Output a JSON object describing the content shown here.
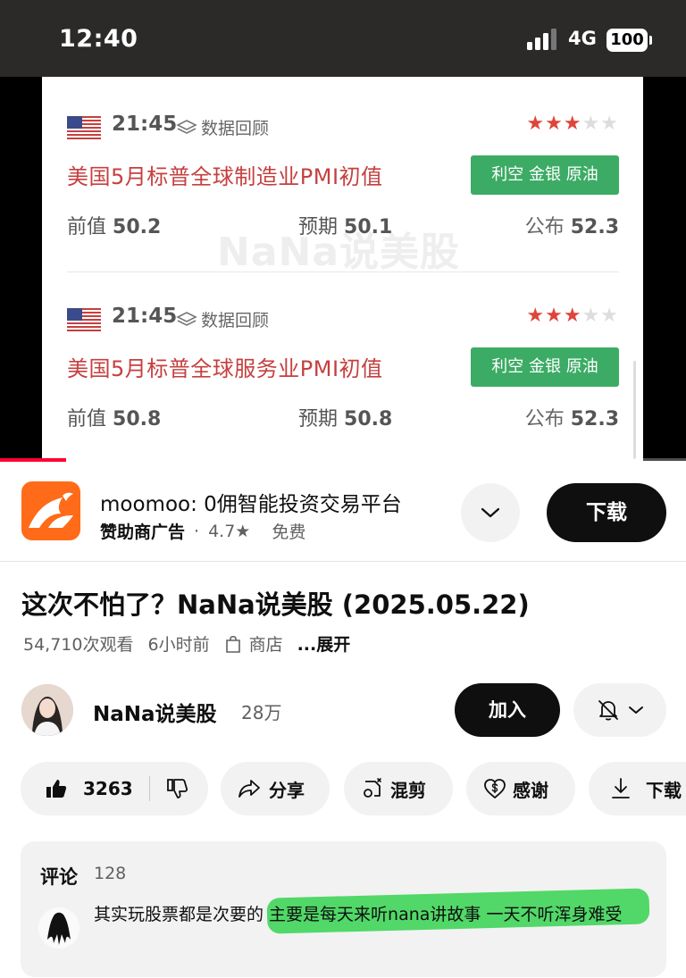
{
  "status_bar": {
    "time": "12:40",
    "network": "4G",
    "battery": "100"
  },
  "video_frame": {
    "watermark": "NaNa说美股",
    "events": [
      {
        "time": "21:45",
        "review_label": "数据回顾",
        "stars_on": 3,
        "stars_total": 5,
        "title": "美国5月标普全球制造业PMI初值",
        "tag": "利空 金银 原油",
        "prev_label": "前值",
        "prev_value": "50.2",
        "expected_label": "预期",
        "expected_value": "50.1",
        "published_label": "公布",
        "published_value": "52.3"
      },
      {
        "time": "21:45",
        "review_label": "数据回顾",
        "stars_on": 3,
        "stars_total": 5,
        "title": "美国5月标普全球服务业PMI初值",
        "tag": "利空 金银 原油",
        "prev_label": "前值",
        "prev_value": "50.8",
        "expected_label": "预期",
        "expected_value": "50.8",
        "published_label": "公布",
        "published_value": "52.3"
      }
    ],
    "progress_fraction": 0.096
  },
  "ad": {
    "title": "moomoo: 0佣智能投资交易平台",
    "sponsor": "赞助商广告",
    "dot": "·",
    "rating": "4.7★",
    "price": "免费",
    "download_label": "下载",
    "colors": {
      "logo_bg": "#ff6b18"
    }
  },
  "video": {
    "title": "这次不怕了？NaNa说美股 (2025.05.22)",
    "views": "54,710次观看",
    "age": "6小时前",
    "store": "商店",
    "more": "...展开"
  },
  "channel": {
    "name": "NaNa说美股",
    "subscribers": "28万",
    "join_label": "加入"
  },
  "actions": {
    "likes": "3263",
    "share": "分享",
    "remix": "混剪",
    "thanks": "感谢",
    "download": "下载"
  },
  "comments": {
    "header": "评论",
    "count": "128",
    "top_comment": "其实玩股票都是次要的 主要是每天来听nana讲故事 一天不听浑身难受"
  }
}
